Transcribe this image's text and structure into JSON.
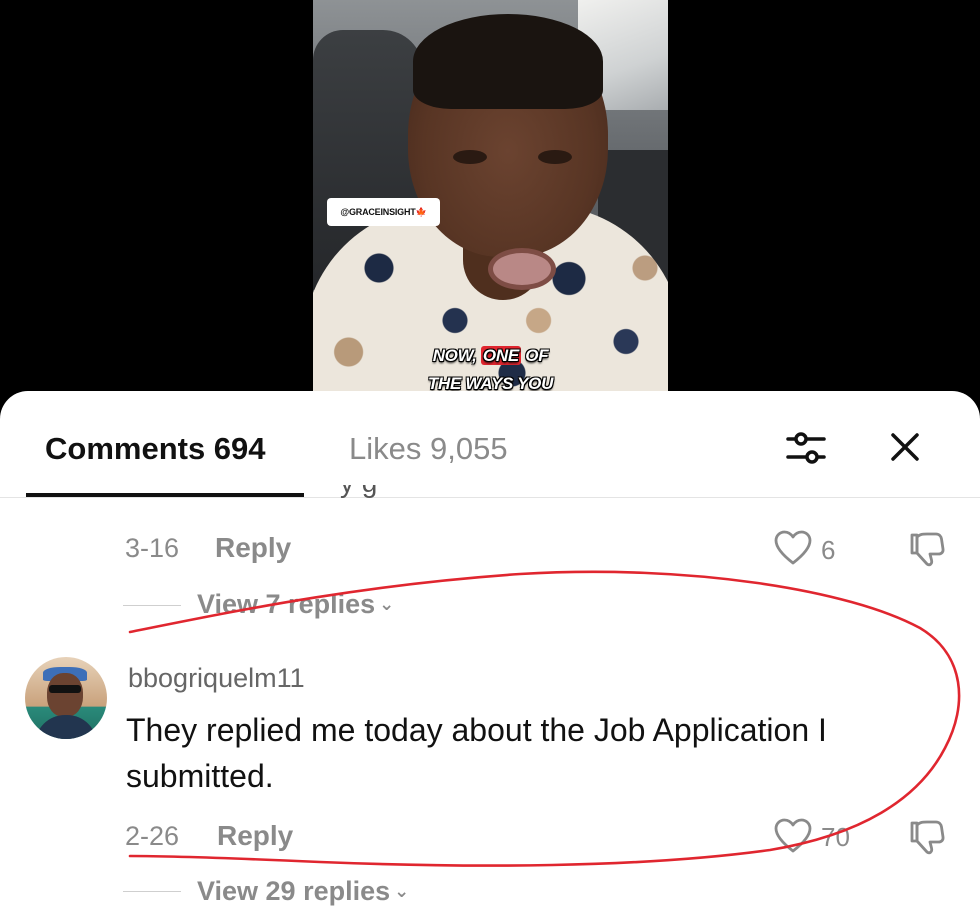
{
  "video": {
    "watermark": "@GRACEINSIGHT",
    "watermark_flag": "🍁",
    "caption_line1_pre": "NOW, ",
    "caption_line1_highlight": "ONE",
    "caption_line1_post": " OF",
    "caption_line2": "THE WAYS YOU"
  },
  "tabs": {
    "comments": "Comments 694",
    "likes": "Likes 9,055"
  },
  "icons": {
    "filter": "filter-sliders-icon",
    "close": "close-icon",
    "like": "heart-outline-icon",
    "dislike": "thumbs-down-outline-icon",
    "chevron": "chevron-down-icon"
  },
  "comment_prev": {
    "cut_text": "y          g",
    "date": "3-16",
    "reply_label": "Reply",
    "like_count": "6",
    "view_replies": "View 7 replies"
  },
  "comment_main": {
    "username": "bbogriquelm11",
    "text": "They replied me today about the Job Application I submitted.",
    "date": "2-26",
    "reply_label": "Reply",
    "like_count": "70",
    "view_replies": "View 29 replies"
  },
  "colors": {
    "annotation_stroke": "#e0262f",
    "muted_text": "#8a8a8a",
    "primary_text": "#111111"
  }
}
